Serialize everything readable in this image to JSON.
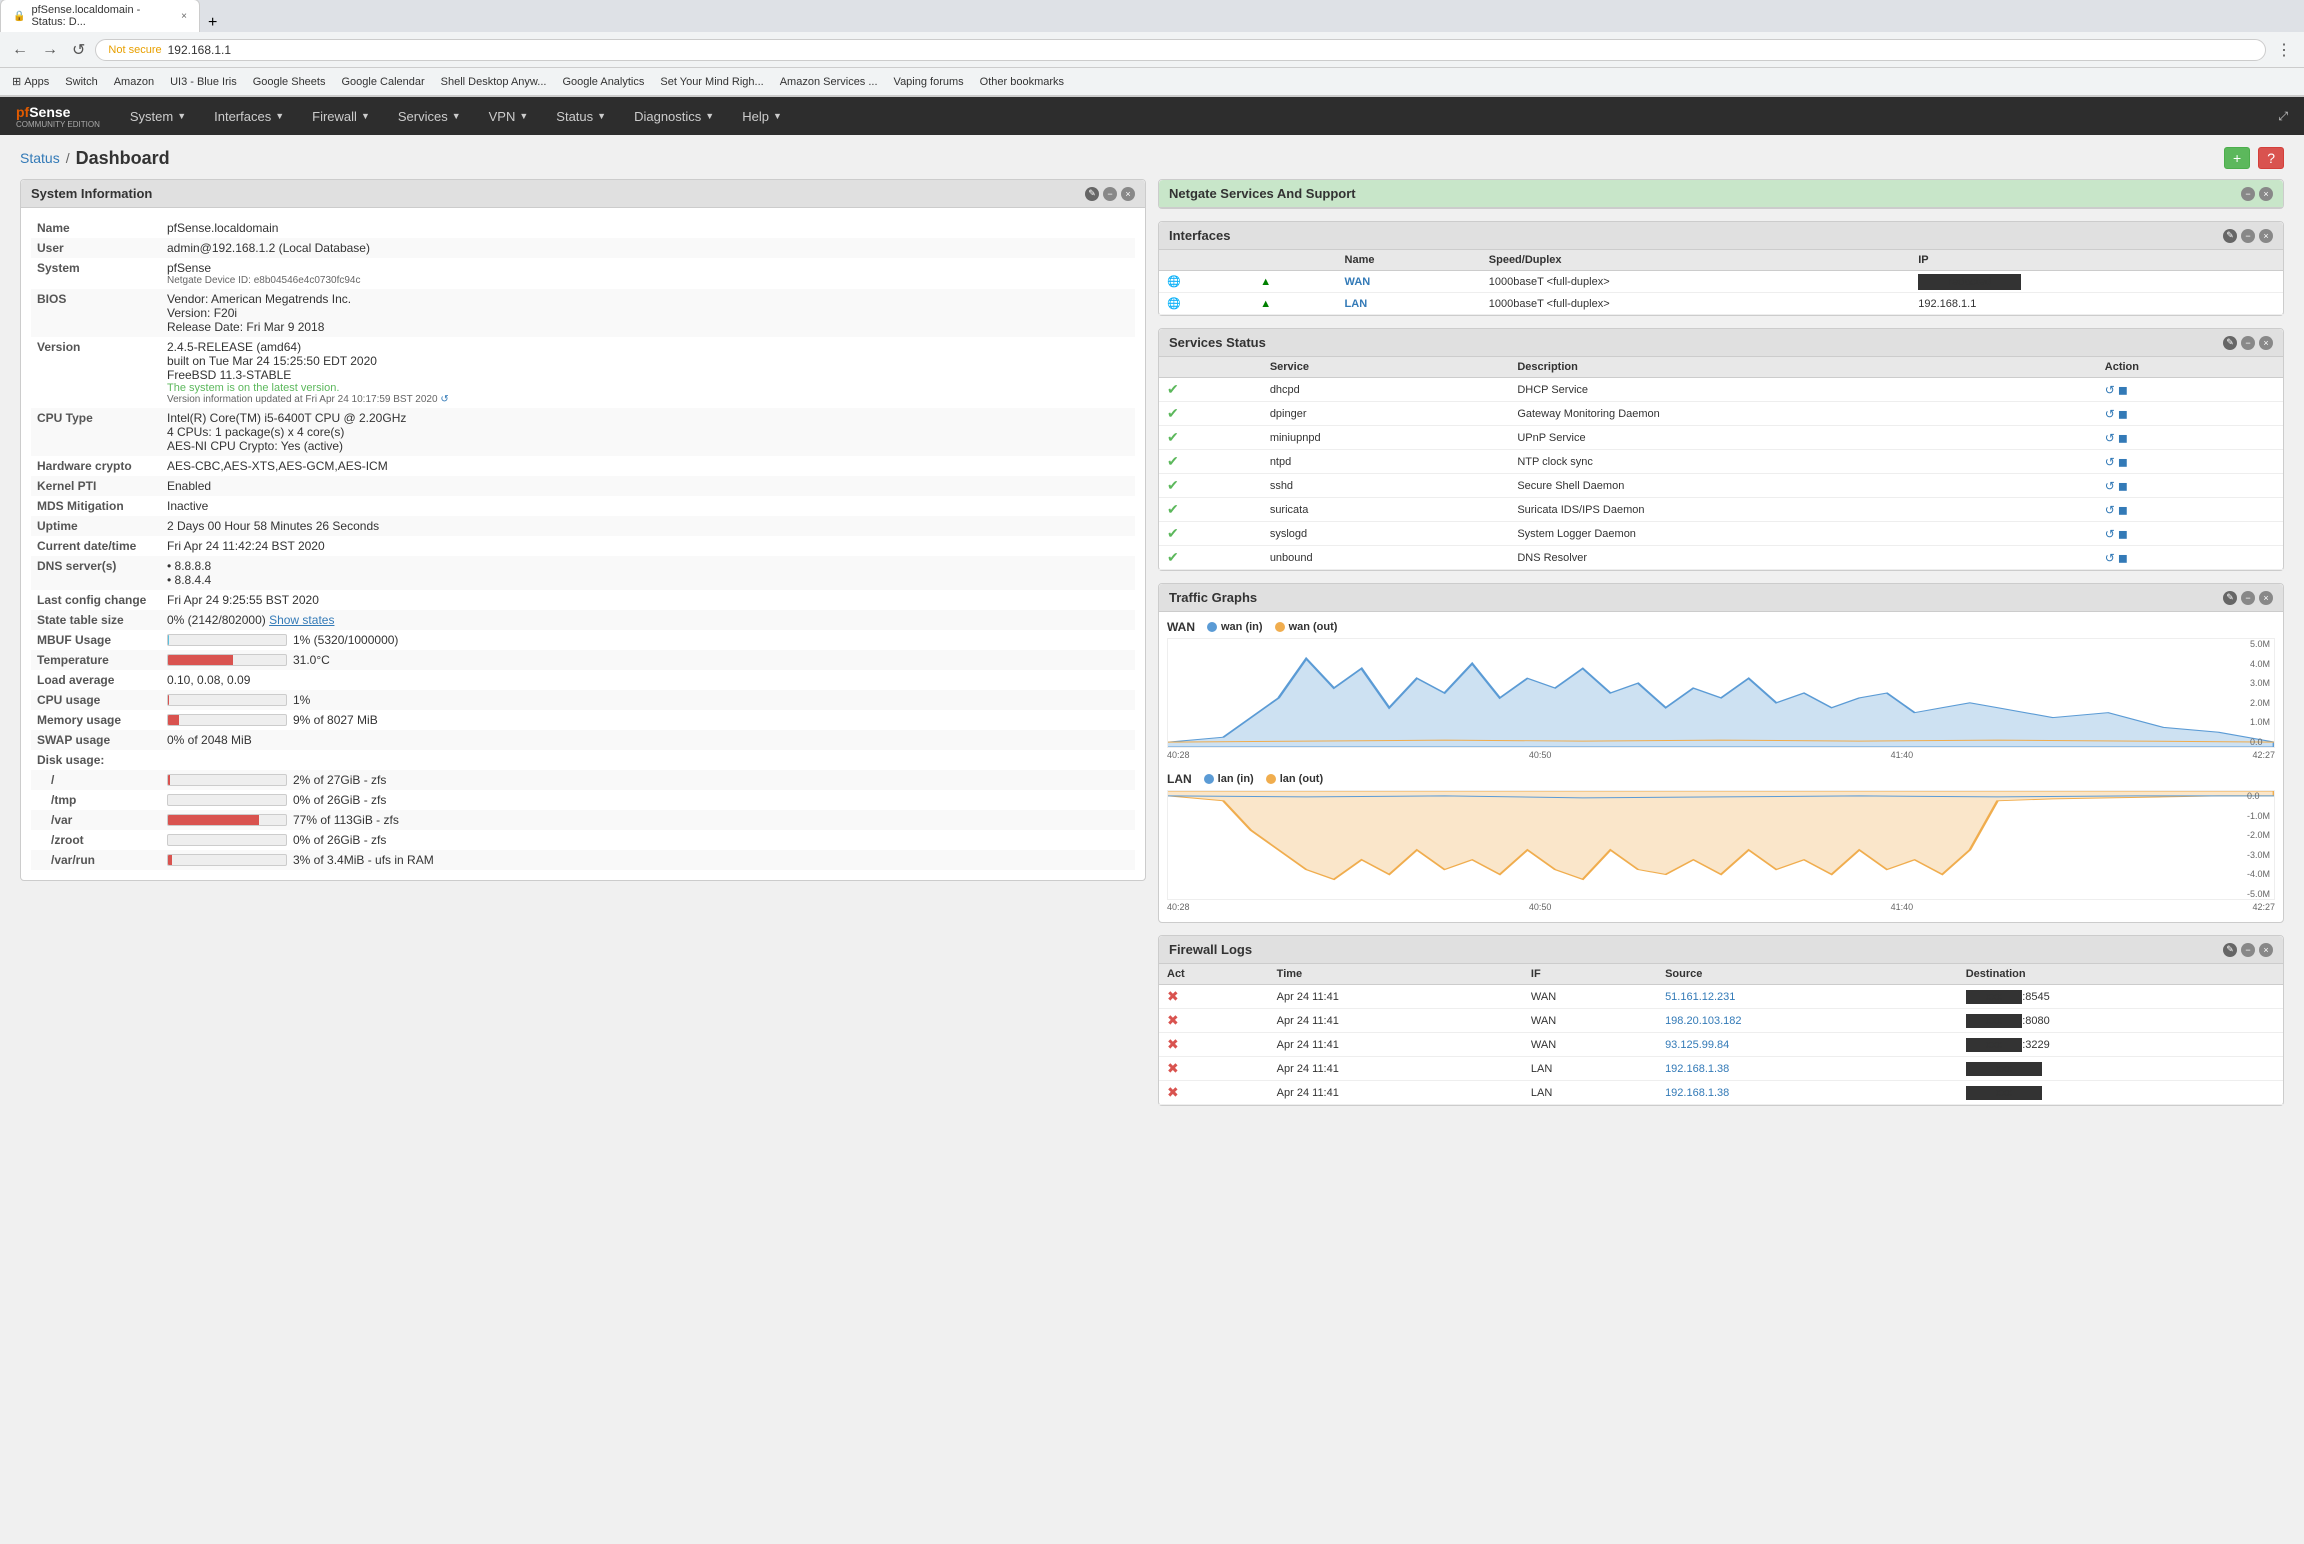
{
  "browser": {
    "tab_title": "pfSense.localdomain - Status: D...",
    "address": "192.168.1.1",
    "not_secure_label": "Not secure",
    "bookmarks": [
      "Apps",
      "Switch",
      "Amazon",
      "UI3 - Blue Iris",
      "Google Sheets",
      "Google Calendar",
      "Shell Desktop Anyw...",
      "Google Analytics",
      "Set Your Mind Righ...",
      "Amazon Services ...",
      "Vaping forums",
      "Other bookmarks"
    ]
  },
  "nav": {
    "logo": "pfSense",
    "logo_sub": "COMMUNITY EDITION",
    "items": [
      {
        "label": "System",
        "has_arrow": true
      },
      {
        "label": "Interfaces",
        "has_arrow": true
      },
      {
        "label": "Firewall",
        "has_arrow": true
      },
      {
        "label": "Services",
        "has_arrow": true
      },
      {
        "label": "VPN",
        "has_arrow": true
      },
      {
        "label": "Status",
        "has_arrow": true
      },
      {
        "label": "Diagnostics",
        "has_arrow": true
      },
      {
        "label": "Help",
        "has_arrow": true
      }
    ]
  },
  "breadcrumb": {
    "parent": "Status",
    "current": "Dashboard"
  },
  "system_info": {
    "title": "System Information",
    "rows": [
      {
        "label": "Name",
        "value": "pfSense.localdomain"
      },
      {
        "label": "User",
        "value": "admin@192.168.1.2 (Local Database)"
      },
      {
        "label": "System",
        "value": "pfSense\nNetgate Device ID: e8b04546e4c0730fc94c"
      },
      {
        "label": "BIOS",
        "value": "Vendor: American Megatrends Inc.\nVersion: F20i\nRelease Date: Fri Mar 9 2018"
      },
      {
        "label": "Version",
        "value": "2.4.5-RELEASE (amd64)\nbuilt on Tue Mar 24 15:25:50 EDT 2020\nFreeBSD 11.3-STABLE"
      },
      {
        "label": "version_status",
        "value": "The system is on the latest version."
      },
      {
        "label": "version_updated",
        "value": "Version information updated at Fri Apr 24 10:17:59 BST 2020"
      },
      {
        "label": "CPU Type",
        "value": "Intel(R) Core(TM) i5-6400T CPU @ 2.20GHz\n4 CPUs: 1 package(s) x 4 core(s)\nAES-NI CPU Crypto: Yes (active)"
      },
      {
        "label": "Hardware crypto",
        "value": "AES-CBC,AES-XTS,AES-GCM,AES-ICM"
      },
      {
        "label": "Kernel PTI",
        "value": "Enabled"
      },
      {
        "label": "MDS Mitigation",
        "value": "Inactive"
      },
      {
        "label": "Uptime",
        "value": "2 Days 00 Hour 58 Minutes 26 Seconds"
      },
      {
        "label": "Current date/time",
        "value": "Fri Apr 24 11:42:24 BST 2020"
      },
      {
        "label": "DNS server(s)",
        "value": "8.8.8.8\n8.8.4.4"
      },
      {
        "label": "Last config change",
        "value": "Fri Apr 24 9:25:55 BST 2020"
      },
      {
        "label": "State table size",
        "value": "0% (2142/802000) Show states"
      },
      {
        "label": "MBUF Usage",
        "value": "1% (5320/1000000)"
      },
      {
        "label": "Temperature",
        "value": "31.0°C"
      },
      {
        "label": "Load average",
        "value": "0.10, 0.08, 0.09"
      },
      {
        "label": "CPU usage",
        "value": "1%"
      },
      {
        "label": "Memory usage",
        "value": "9% of 8027 MiB"
      },
      {
        "label": "SWAP usage",
        "value": "0% of 2048 MiB"
      },
      {
        "label": "Disk usage /",
        "value": "2% of 27GiB - zfs"
      },
      {
        "label": "Disk usage /tmp",
        "value": "0% of 26GiB - zfs"
      },
      {
        "label": "Disk usage /var",
        "value": "77% of 113GiB - zfs"
      },
      {
        "label": "Disk usage /zroot",
        "value": "0% of 26GiB - zfs"
      },
      {
        "label": "Disk usage /var/run",
        "value": "3% of 3.4MiB - ufs in RAM"
      }
    ]
  },
  "netgate_support": {
    "title": "Netgate Services And Support"
  },
  "interfaces": {
    "title": "Interfaces",
    "columns": [
      "",
      "",
      "Name",
      "Speed/Duplex",
      "IP"
    ],
    "rows": [
      {
        "icon": "network",
        "status": "up",
        "name": "WAN",
        "speed": "1000baseT <full-duplex>",
        "ip": ""
      },
      {
        "icon": "network",
        "status": "up",
        "name": "LAN",
        "speed": "1000baseT <full-duplex>",
        "ip": "192.168.1.1"
      }
    ]
  },
  "services_status": {
    "title": "Services Status",
    "columns": [
      "Service",
      "Description",
      "Action"
    ],
    "rows": [
      {
        "name": "dhcpd",
        "desc": "DHCP Service",
        "running": true
      },
      {
        "name": "dpinger",
        "desc": "Gateway Monitoring Daemon",
        "running": true
      },
      {
        "name": "miniupnpd",
        "desc": "UPnP Service",
        "running": true
      },
      {
        "name": "ntpd",
        "desc": "NTP clock sync",
        "running": true
      },
      {
        "name": "sshd",
        "desc": "Secure Shell Daemon",
        "running": true
      },
      {
        "name": "suricata",
        "desc": "Suricata IDS/IPS Daemon",
        "running": true
      },
      {
        "name": "syslogd",
        "desc": "System Logger Daemon",
        "running": true
      },
      {
        "name": "unbound",
        "desc": "DNS Resolver",
        "running": true
      }
    ]
  },
  "traffic_graphs": {
    "title": "Traffic Graphs",
    "wan": {
      "label": "WAN",
      "legend_in": "wan (in)",
      "legend_out": "wan (out)",
      "color_in": "#5b9bd5",
      "color_out": "#f0ad4e",
      "y_labels": [
        "5.0M",
        "4.0M",
        "3.0M",
        "2.0M",
        "1.0M",
        "0.0"
      ],
      "x_labels": [
        "40:28",
        "40:50",
        "41:40",
        "42:27"
      ]
    },
    "lan": {
      "label": "LAN",
      "legend_in": "lan (in)",
      "legend_out": "lan (out)",
      "color_in": "#5b9bd5",
      "color_out": "#f0ad4e",
      "y_labels": [
        "0.0",
        "-1.0M",
        "-2.0M",
        "-3.0M",
        "-4.0M",
        "-5.0M"
      ],
      "x_labels": [
        "40:28",
        "40:50",
        "41:40",
        "42:27"
      ]
    }
  },
  "firewall_logs": {
    "title": "Firewall Logs",
    "columns": [
      "Act",
      "Time",
      "IF",
      "Source",
      "Destination"
    ],
    "rows": [
      {
        "act": "block",
        "time": "Apr 24 11:41",
        "if": "WAN",
        "source": "51.161.12.231",
        "dest_port": "8545"
      },
      {
        "act": "block",
        "time": "Apr 24 11:41",
        "if": "WAN",
        "source": "198.20.103.182",
        "dest_port": "8080"
      },
      {
        "act": "block",
        "time": "Apr 24 11:41",
        "if": "WAN",
        "source": "93.125.99.84",
        "dest_port": "3229"
      },
      {
        "act": "block",
        "time": "Apr 24 11:41",
        "if": "LAN",
        "source": "192.168.1.38",
        "dest_port": ""
      },
      {
        "act": "block",
        "time": "Apr 24 11:41",
        "if": "LAN",
        "source": "192.168.1.38",
        "dest_port": ""
      }
    ]
  },
  "icons": {
    "edit": "✎",
    "minus": "−",
    "close": "×",
    "refresh": "↺",
    "plus": "+",
    "question": "?",
    "arrow_up": "▲",
    "arrow_down": "▼",
    "restart": "↺",
    "stop": "◼"
  }
}
